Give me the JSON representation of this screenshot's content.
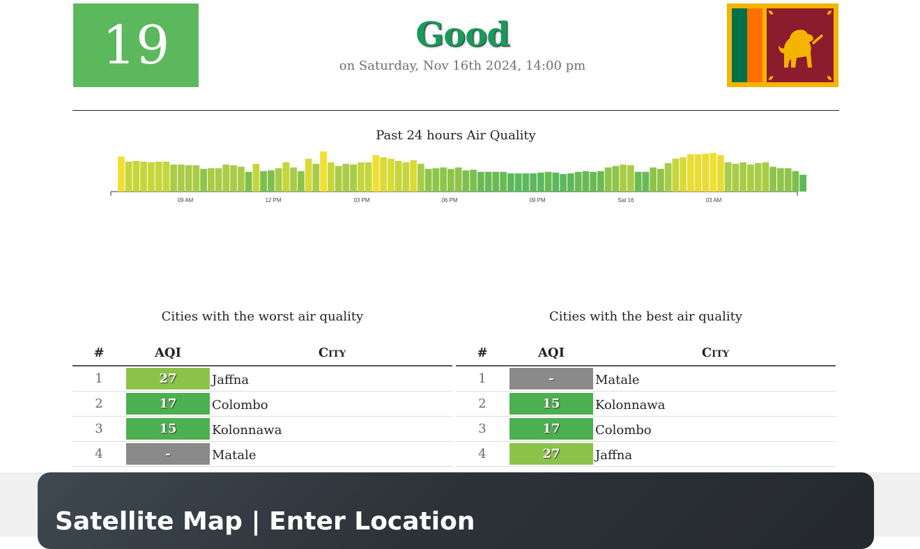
{
  "header": {
    "aqi_value": "19",
    "status": "Good",
    "date": "on Saturday, Nov 16th 2024, 14:00 pm",
    "aqi_color": "#5cb85c",
    "flag": "sri-lanka-flag"
  },
  "chart_data": {
    "type": "bar",
    "title": "Past 24 hours Air Quality",
    "xticks": [
      "09 AM",
      "12 PM",
      "03 PM",
      "06 PM",
      "09 PM",
      "Sat 16",
      "03 AM"
    ],
    "values": [
      48,
      41,
      42,
      41,
      40,
      41,
      41,
      37,
      37,
      36,
      36,
      31,
      32,
      32,
      37,
      36,
      34,
      27,
      38,
      28,
      29,
      32,
      40,
      33,
      28,
      45,
      38,
      55,
      40,
      35,
      38,
      37,
      40,
      40,
      50,
      47,
      45,
      42,
      40,
      43,
      38,
      31,
      32,
      33,
      31,
      33,
      29,
      30,
      27,
      27,
      27,
      27,
      25,
      25,
      25,
      25,
      26,
      27,
      26,
      24,
      25,
      27,
      28,
      27,
      28,
      33,
      35,
      37,
      36,
      27,
      27,
      33,
      31,
      39,
      45,
      47,
      51,
      51,
      52,
      53,
      50,
      40,
      38,
      40,
      37,
      39,
      40,
      34,
      32,
      32,
      28,
      23
    ],
    "colors": [
      "#f2df33",
      "#c5d63c",
      "#c5d63c",
      "#c5d63c",
      "#c5d63c",
      "#c5d63c",
      "#c5d63c",
      "#a8cc47",
      "#a8cc47",
      "#a8cc47",
      "#a8cc47",
      "#8ec44a",
      "#a8cc47",
      "#a8cc47",
      "#a8cc47",
      "#a8cc47",
      "#a8cc47",
      "#7dbf4d",
      "#c5d63c",
      "#7dbf4d",
      "#7dbf4d",
      "#a8cc47",
      "#c5d63c",
      "#a8cc47",
      "#8ec44a",
      "#d9da38",
      "#a8cc47",
      "#f2df33",
      "#c5d63c",
      "#a8cc47",
      "#a8cc47",
      "#a8cc47",
      "#c5d63c",
      "#c5d63c",
      "#f2df33",
      "#d9da38",
      "#d9da38",
      "#c5d63c",
      "#c5d63c",
      "#d9da38",
      "#a8cc47",
      "#8ec44a",
      "#8ec44a",
      "#8ec44a",
      "#8ec44a",
      "#8ec44a",
      "#7dbf4d",
      "#7dbf4d",
      "#6aba54",
      "#6aba54",
      "#6aba54",
      "#6aba54",
      "#5cb85c",
      "#5cb85c",
      "#5cb85c",
      "#5cb85c",
      "#5cb85c",
      "#6aba54",
      "#5cb85c",
      "#5cb85c",
      "#5cb85c",
      "#6aba54",
      "#6aba54",
      "#6aba54",
      "#6aba54",
      "#8ec44a",
      "#8ec44a",
      "#a8cc47",
      "#a8cc47",
      "#6aba54",
      "#6aba54",
      "#8ec44a",
      "#8ec44a",
      "#a8cc47",
      "#c5d63c",
      "#d9da38",
      "#e8dc35",
      "#e8dc35",
      "#e8dc35",
      "#f2df33",
      "#e8dc35",
      "#a8cc47",
      "#a8cc47",
      "#a8cc47",
      "#a8cc47",
      "#a8cc47",
      "#a8cc47",
      "#8ec44a",
      "#8ec44a",
      "#8ec44a",
      "#7dbf4d",
      "#5cb85c"
    ]
  },
  "worst": {
    "title": "Cities with the worst air quality",
    "headers": {
      "num": "#",
      "aqi": "AQI",
      "city": "City"
    },
    "rows": [
      {
        "num": "1",
        "aqi": "27",
        "city": "Jaffna",
        "color": "#8bc34a"
      },
      {
        "num": "2",
        "aqi": "17",
        "city": "Colombo",
        "color": "#4caf50"
      },
      {
        "num": "3",
        "aqi": "15",
        "city": "Kolonnawa",
        "color": "#4caf50"
      },
      {
        "num": "4",
        "aqi": "-",
        "city": "Matale",
        "color": "#8a8a8a"
      }
    ]
  },
  "best": {
    "title": "Cities with the best air quality",
    "headers": {
      "num": "#",
      "aqi": "AQI",
      "city": "City"
    },
    "rows": [
      {
        "num": "1",
        "aqi": "-",
        "city": "Matale",
        "color": "#8a8a8a"
      },
      {
        "num": "2",
        "aqi": "15",
        "city": "Kolonnawa",
        "color": "#4caf50"
      },
      {
        "num": "3",
        "aqi": "17",
        "city": "Colombo",
        "color": "#4caf50"
      },
      {
        "num": "4",
        "aqi": "27",
        "city": "Jaffna",
        "color": "#8bc34a"
      }
    ]
  },
  "map": {
    "title": "Satellite Map | Enter Location"
  }
}
